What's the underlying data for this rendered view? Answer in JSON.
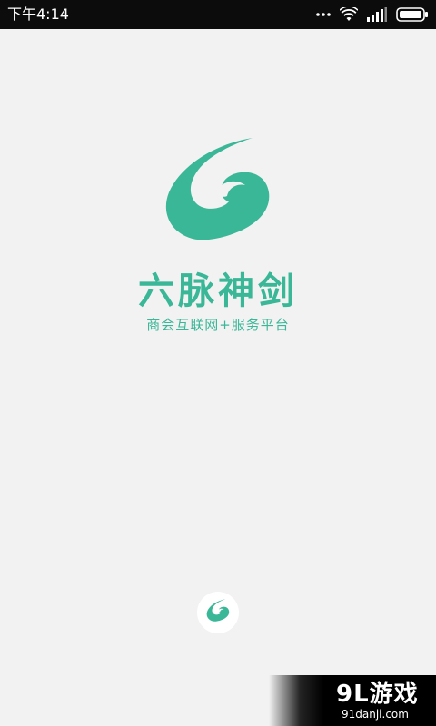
{
  "status_bar": {
    "time": "下午4:14",
    "icons": [
      "more-dots-icon",
      "wifi-icon",
      "signal-icon",
      "battery-icon"
    ]
  },
  "splash": {
    "brand_name": "六脉神剑",
    "tagline": "商会互联网+服务平台",
    "logo_icon": "six-swirl-logo",
    "accent_color": "#3ab797",
    "background_color": "#f2f2f2"
  },
  "watermark": {
    "brand": "9L游戏",
    "url": "91danji.com"
  }
}
